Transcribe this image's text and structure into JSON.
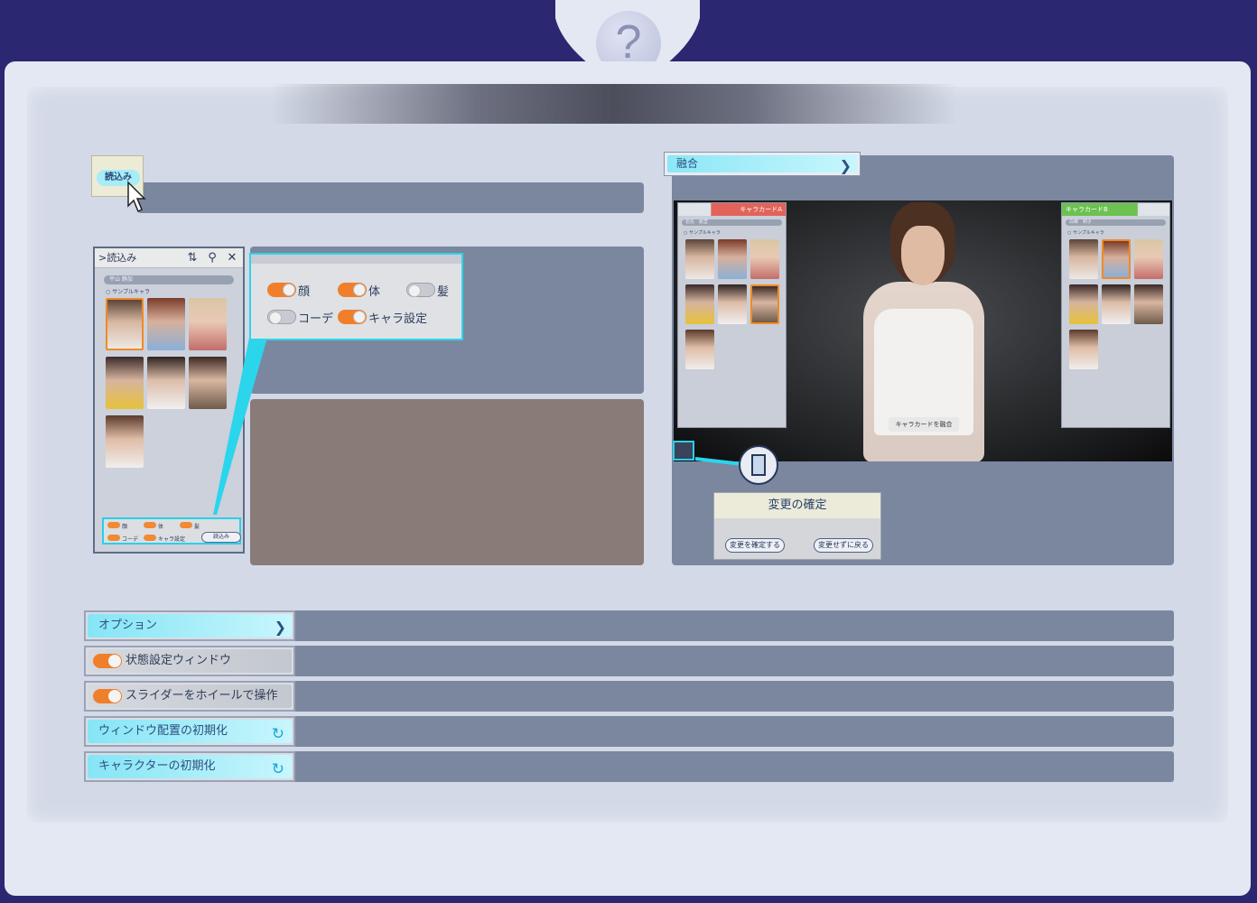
{
  "help": {
    "icon": "question-icon",
    "glyph": "?"
  },
  "load_section": {
    "load_button_label": "読込み",
    "window": {
      "title": "読込み",
      "name_bar": "平山 静加",
      "sample_label": "サンプルキャラ",
      "options": [
        {
          "label": "顔",
          "on": true
        },
        {
          "label": "体",
          "on": true
        },
        {
          "label": "髪",
          "on": true
        },
        {
          "label": "コーデ",
          "on": true
        },
        {
          "label": "キャラ設定",
          "on": true
        }
      ],
      "load_label": "読込み"
    },
    "zoom_options": [
      {
        "label": "顔",
        "on": true
      },
      {
        "label": "体",
        "on": true
      },
      {
        "label": "髪",
        "on": false
      },
      {
        "label": "コーデ",
        "on": false
      },
      {
        "label": "キャラ設定",
        "on": true
      }
    ]
  },
  "fusion_section": {
    "header": "融合",
    "card_a": "キャラカードA",
    "card_b": "キャラカードB",
    "name_a": "岩島　絵里",
    "name_b": "白峰　莉子",
    "sample_label": "サンプルキャラ",
    "fuse_button": "キャラカードを融合",
    "confirm": {
      "title": "変更の確定",
      "confirm_button": "変更を確定する",
      "revert_button": "変更せずに戻る"
    }
  },
  "options": {
    "header": "オプション",
    "state_window": "状態設定ウィンドウ",
    "wheel_slider": "スライダーをホイールで操作",
    "reset_window": "ウィンドウ配置の初期化",
    "reset_character": "キャラクターの初期化"
  }
}
